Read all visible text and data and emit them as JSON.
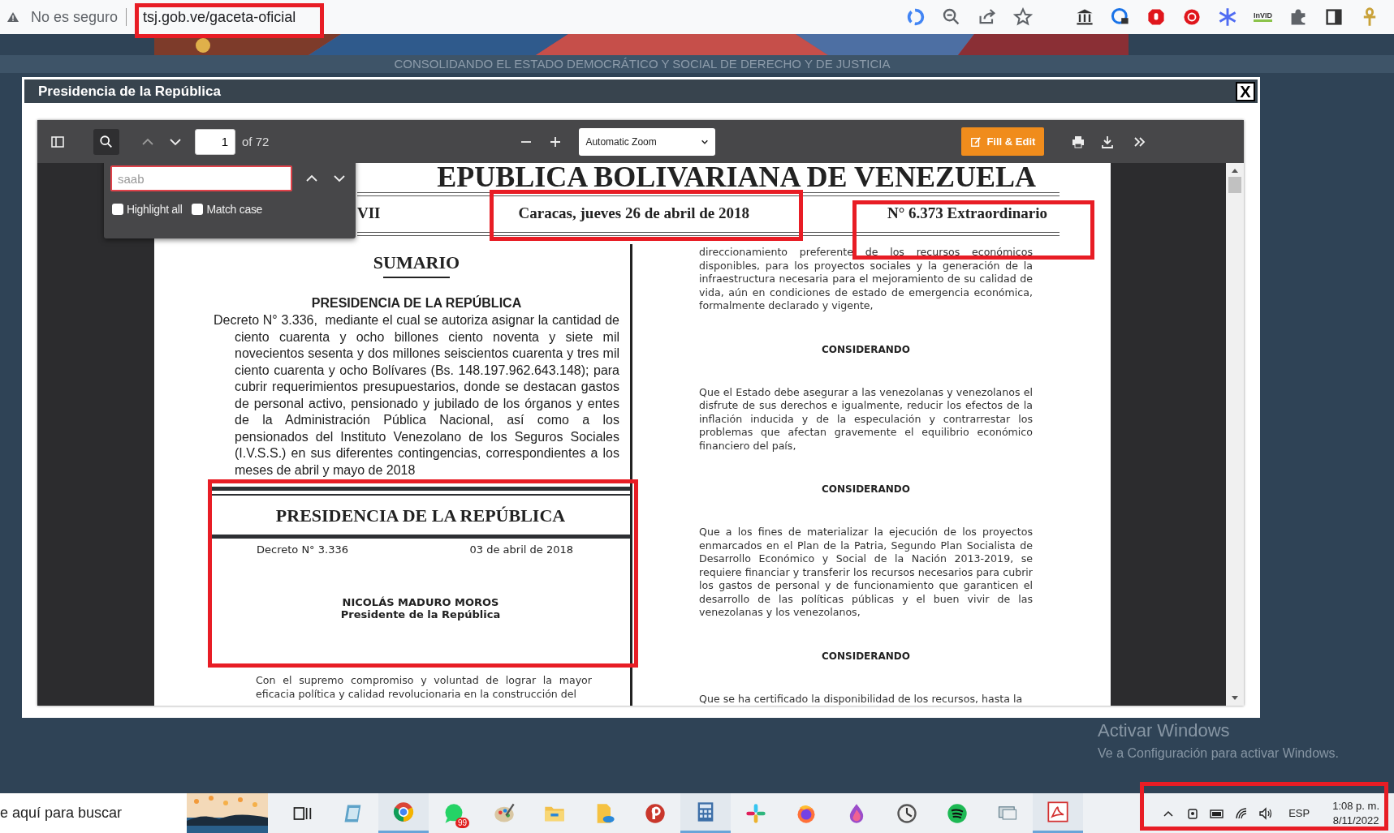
{
  "browser": {
    "security": "No es seguro",
    "url": "tsj.gob.ve/gaceta-oficial",
    "extension_label": "InVID"
  },
  "site": {
    "motto": "CONSOLIDANDO EL ESTADO DEMOCRÁTICO Y SOCIAL DE DERECHO Y DE JUSTICIA"
  },
  "modal": {
    "title": "Presidencia de la República",
    "close": "X"
  },
  "viewer": {
    "page_number": "1",
    "page_count": "of 72",
    "zoom": "Automatic Zoom",
    "fill_edit": "Fill & Edit",
    "find": {
      "value": "saab",
      "not_found": true,
      "options": [
        {
          "label": "Highlight all",
          "checked": false
        },
        {
          "label": "Match case",
          "checked": false
        }
      ]
    }
  },
  "document": {
    "masthead": "EPUBLICA BOLIVARIANA DE VENEZUELA",
    "year": "VII",
    "date": "Caracas, jueves 26 de abril de 2018",
    "issue": "N° 6.373 Extraordinario",
    "left": {
      "title": "SUMARIO",
      "heading": "PRESIDENCIA DE LA REPÚBLICA",
      "summary": "Decreto N° 3.336,  mediante el cual se autoriza asignar la cantidad de ciento cuarenta y ocho billones ciento noventa y siete mil novecientos sesenta y dos millones seiscientos cuarenta y tres mil ciento cuarenta y ocho Bolívares (Bs. 148.197.962.643.148); para cubrir requerimientos presupuestarios, donde se destacan gastos de personal activo, pensionado y jubilado de los órganos y entes de la Administración Pública Nacional, así como a los pensionados del Instituto Venezolano de los Seguros Sociales (I.V.S.S.) en sus diferentes contingencias, correspondientes a los meses de abril y mayo de 2018",
      "section": "PRESIDENCIA DE LA REPÚBLICA",
      "decree": "Decreto N° 3.336",
      "decree_date": "03 de abril de 2018",
      "signer": "NICOLÁS MADURO MOROS",
      "signer_role": "Presidente de la República",
      "body": "Con el supremo compromiso y voluntad de lograr la mayor eficacia política y calidad revolucionaria en la construcción del"
    },
    "right": [
      {
        "kind": "paragraph",
        "text": "direccionamiento preferente de los recursos económicos disponibles, para los proyectos sociales y la generación de la infraestructura necesaria para el mejoramiento de su calidad de vida, aún en condiciones de estado de emergencia económica, formalmente declarado y vigente,"
      },
      {
        "kind": "heading",
        "text": "CONSIDERANDO"
      },
      {
        "kind": "paragraph",
        "text": "Que el Estado debe asegurar a las venezolanas y venezolanos el disfrute de sus derechos e igualmente, reducir los efectos de la inflación inducida y de la especulación y contrarrestar los problemas que afectan gravemente el equilibrio económico financiero del país,"
      },
      {
        "kind": "heading",
        "text": "CONSIDERANDO"
      },
      {
        "kind": "paragraph",
        "text": "Que a los fines de materializar la ejecución de los proyectos enmarcados en el Plan de la Patria, Segundo Plan Socialista de Desarrollo Económico y Social de la Nación 2013-2019, se requiere financiar y transferir los recursos necesarios para cubrir los gastos de personal y de funcionamiento que garanticen el desarrollo de las políticas públicas y el buen vivir de las venezolanas y los venezolanos,"
      },
      {
        "kind": "heading",
        "text": "CONSIDERANDO"
      },
      {
        "kind": "paragraph",
        "text": "Que se ha certificado la disponibilidad de los recursos, hasta la"
      }
    ]
  },
  "desktop": {
    "activation_title": "Activar Windows",
    "activation_text": "Ve a Configuración para activar Windows."
  },
  "taskbar": {
    "search": "e aquí para buscar",
    "badge": "99",
    "language": "ESP",
    "time": "1:08 p. m.",
    "date": "8/11/2022"
  }
}
